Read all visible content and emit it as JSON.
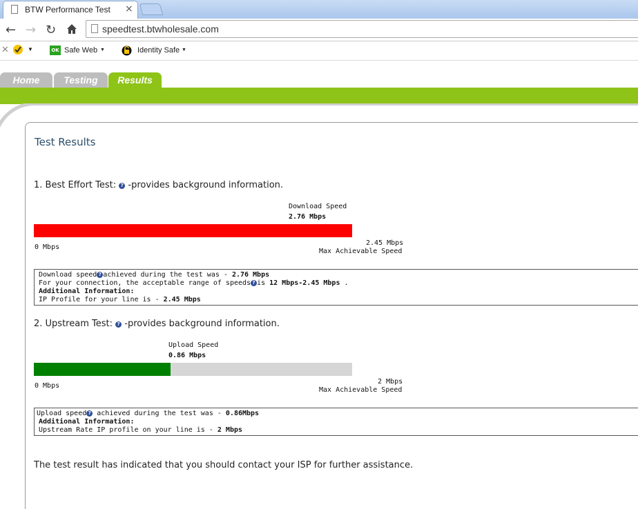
{
  "browser": {
    "tab_title": "BTW Performance Test",
    "url": "speedtest.btwholesale.com",
    "ext_safe_web": "Safe Web",
    "ext_identity_safe": "Identity Safe",
    "ext_ok_badge": "OK"
  },
  "site_nav": {
    "tabs": [
      {
        "label": "Home",
        "active": false
      },
      {
        "label": "Testing",
        "active": false
      },
      {
        "label": "Results",
        "active": true
      }
    ],
    "colors": {
      "inactive": "#bdbdbd",
      "active": "#8ec418"
    }
  },
  "page": {
    "heading": "Test Results",
    "best_effort": {
      "title_prefix": "1. Best Effort Test:",
      "title_suffix": "-provides background information.",
      "speed_label": "Download Speed",
      "speed_value": "2.76 Mbps",
      "fill_fraction": 1.0,
      "fill_color": "#ff0000",
      "min_label": "0 Mbps",
      "max_value": "2.45 Mbps",
      "max_label": "Max Achievable Speed",
      "info": {
        "l1_pre": "Download speed",
        "l1_mid": "achieved during the test was - ",
        "l1_val": "2.76 Mbps",
        "l2_pre": "For your connection, the acceptable range of speeds",
        "l2_mid": "is ",
        "l2_val": "12 Mbps-2.45 Mbps",
        "l2_post": " .",
        "l3": "Additional Information:",
        "l4_pre": "IP Profile for your line is - ",
        "l4_val": "2.45 Mbps"
      }
    },
    "upstream": {
      "title_prefix": "2. Upstream Test:",
      "title_suffix": "-provides background information.",
      "speed_label": "Upload Speed",
      "speed_value": "0.86 Mbps",
      "fill_fraction": 0.43,
      "fill_color": "#008000",
      "min_label": "0 Mbps",
      "max_value": "2 Mbps",
      "max_label": "Max Achievable Speed",
      "info": {
        "l1_pre": "Upload speed",
        "l1_mid": " achieved during the test was - ",
        "l1_val": "0.86Mbps",
        "l2": "Additional Information:",
        "l3_pre": "Upstream Rate IP profile on your line is - ",
        "l3_val": "2 Mbps"
      }
    },
    "conclusion": "The test result has indicated that you should contact your ISP for further assistance."
  }
}
